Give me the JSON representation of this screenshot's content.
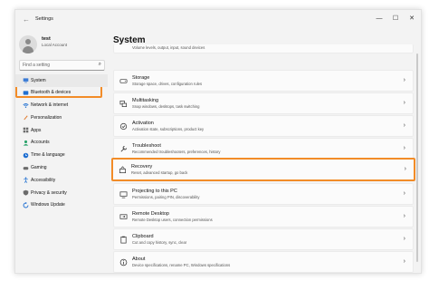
{
  "window": {
    "title": "Settings",
    "controls": {
      "minimize": "—",
      "maximize": "☐",
      "close": "✕"
    }
  },
  "profile": {
    "name": "test",
    "account": "Local Account"
  },
  "search": {
    "placeholder": "Find a setting",
    "icon": "search-icon"
  },
  "sidebar": {
    "active_index": 0,
    "items": [
      {
        "label": "System",
        "icon": "system-icon",
        "color": "#3a7bd5"
      },
      {
        "label": "Bluetooth & devices",
        "icon": "bluetooth-icon",
        "color": "#1f6fd1"
      },
      {
        "label": "Network & internet",
        "icon": "wifi-icon",
        "color": "#1f6fd1"
      },
      {
        "label": "Personalization",
        "icon": "brush-icon",
        "color": "#e07a2b"
      },
      {
        "label": "Apps",
        "icon": "apps-icon",
        "color": "#6b6b6b"
      },
      {
        "label": "Accounts",
        "icon": "account-icon",
        "color": "#2aa36b"
      },
      {
        "label": "Time & language",
        "icon": "clock-icon",
        "color": "#1f6fd1"
      },
      {
        "label": "Gaming",
        "icon": "gaming-icon",
        "color": "#6b6b6b"
      },
      {
        "label": "Accessibility",
        "icon": "accessibility-icon",
        "color": "#1f6fd1"
      },
      {
        "label": "Privacy & security",
        "icon": "shield-icon",
        "color": "#6b6b6b"
      },
      {
        "label": "Windows Update",
        "icon": "update-icon",
        "color": "#1f6fd1"
      }
    ]
  },
  "main": {
    "title": "System",
    "items": [
      {
        "title": "",
        "subtitle": "Volume levels, output, input, sound devices",
        "icon": "sound-icon"
      },
      {
        "title": "Storage",
        "subtitle": "Storage space, drives, configuration rules",
        "icon": "storage-icon"
      },
      {
        "title": "Multitasking",
        "subtitle": "Snap windows, desktops, task switching",
        "icon": "multitasking-icon"
      },
      {
        "title": "Activation",
        "subtitle": "Activation state, subscriptions, product key",
        "icon": "activation-icon"
      },
      {
        "title": "Troubleshoot",
        "subtitle": "Recommended troubleshooters, preferences, history",
        "icon": "wrench-icon"
      },
      {
        "title": "Recovery",
        "subtitle": "Reset, advanced startup, go back",
        "icon": "recovery-icon"
      },
      {
        "title": "Projecting to this PC",
        "subtitle": "Permissions, pairing PIN, discoverability",
        "icon": "projecting-icon"
      },
      {
        "title": "Remote Desktop",
        "subtitle": "Remote Desktop users, connection permissions",
        "icon": "remote-desktop-icon"
      },
      {
        "title": "Clipboard",
        "subtitle": "Cut and copy history, sync, clear",
        "icon": "clipboard-icon"
      },
      {
        "title": "About",
        "subtitle": "Device specifications, rename PC, Windows specifications",
        "icon": "info-icon"
      }
    ]
  },
  "accent": "#f28c28"
}
